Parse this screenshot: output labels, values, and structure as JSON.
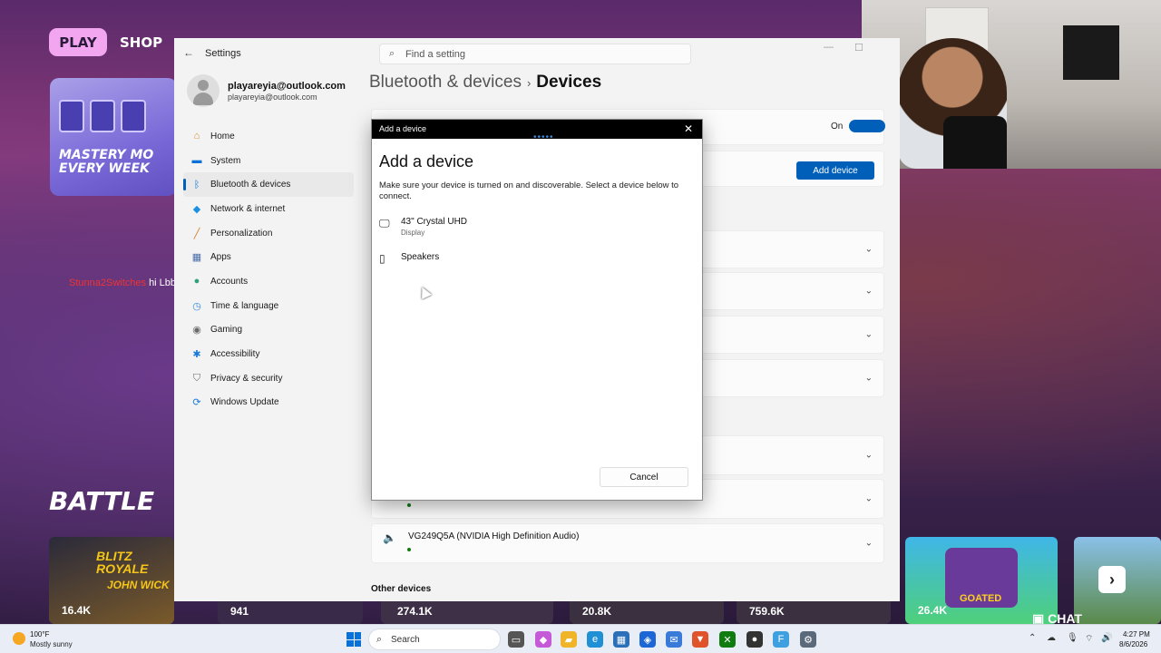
{
  "game": {
    "play_label": "PLAY",
    "shop_label": "SHOP",
    "promo_text": "MASTERY MO EVERY WEEK",
    "battle_text": "BATTLE",
    "chat_user": "Stunna2Switches",
    "chat_message": "hi Lbby",
    "tile_counts": [
      "16.4K",
      "941",
      "274.1K",
      "20.8K",
      "759.6K",
      "26.4K"
    ],
    "tile_titles": [
      "BLITZ ROYALE",
      "JOHN WICK",
      "GOATED"
    ],
    "chat_button": "CHAT"
  },
  "settings": {
    "app_title": "Settings",
    "search_placeholder": "Find a setting",
    "profile_name": "playareyia@outlook.com",
    "profile_email": "playareyia@outlook.com",
    "nav": [
      {
        "label": "Home",
        "icon": "home-icon",
        "color": "#d48a2e"
      },
      {
        "label": "System",
        "icon": "system-icon",
        "color": "#0a72d6"
      },
      {
        "label": "Bluetooth & devices",
        "icon": "bluetooth-icon",
        "color": "#0a72d6",
        "active": true
      },
      {
        "label": "Network & internet",
        "icon": "network-icon",
        "color": "#1b8fe0"
      },
      {
        "label": "Personalization",
        "icon": "brush-icon",
        "color": "#d3802a"
      },
      {
        "label": "Apps",
        "icon": "apps-icon",
        "color": "#4a6fa8"
      },
      {
        "label": "Accounts",
        "icon": "accounts-icon",
        "color": "#2aa37a"
      },
      {
        "label": "Time & language",
        "icon": "clock-icon",
        "color": "#2a88d8"
      },
      {
        "label": "Gaming",
        "icon": "gaming-icon",
        "color": "#6a6a6a"
      },
      {
        "label": "Accessibility",
        "icon": "accessibility-icon",
        "color": "#1a7ad8"
      },
      {
        "label": "Privacy & security",
        "icon": "shield-icon",
        "color": "#6b6b6b"
      },
      {
        "label": "Windows Update",
        "icon": "update-icon",
        "color": "#1a7ad8"
      }
    ],
    "breadcrumb_parent": "Bluetooth & devices",
    "breadcrumb_current": "Devices",
    "bluetooth_state": "On",
    "add_device_label": "Add device",
    "visible_device": "VG249Q5A (NVIDIA High Definition Audio)",
    "other_devices_header": "Other devices"
  },
  "dialog": {
    "window_title": "Add a device",
    "heading": "Add a device",
    "description": "Make sure your device is turned on and discoverable. Select a device below to connect.",
    "devices": [
      {
        "name": "43\" Crystal UHD",
        "type": "Display",
        "icon": "monitor-icon"
      },
      {
        "name": "Speakers",
        "type": "",
        "icon": "speaker-icon"
      }
    ],
    "cancel_label": "Cancel"
  },
  "taskbar": {
    "temperature": "100°F",
    "condition": "Mostly sunny",
    "search_label": "Search",
    "time": "4:27 PM",
    "date": "8/6/2026"
  },
  "colors": {
    "accent": "#005fb8",
    "play_button": "#f3a6f0"
  }
}
